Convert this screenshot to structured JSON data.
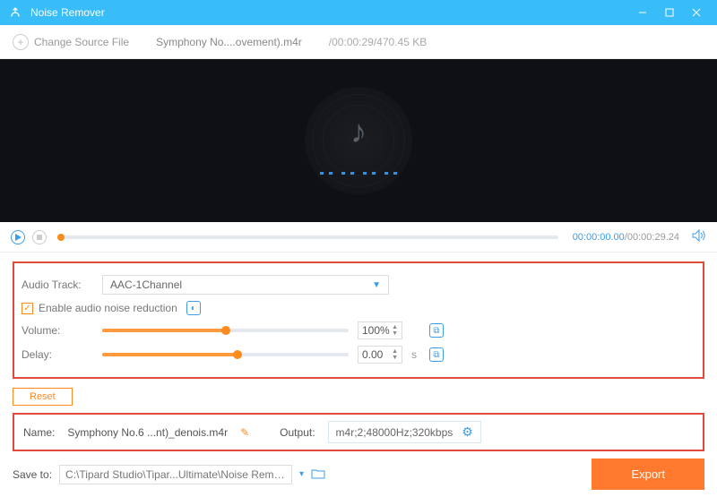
{
  "titlebar": {
    "title": "Noise Remover"
  },
  "toolbar": {
    "change_label": "Change Source File",
    "filename": "Symphony No....ovement).m4r",
    "fileinfo": "/00:00:29/470.45 KB"
  },
  "playbar": {
    "current": "00:00:00.00",
    "duration": "00:00:29.24"
  },
  "audio": {
    "track_label": "Audio Track:",
    "track_value": "AAC-1Channel",
    "enable_label": "Enable audio noise reduction",
    "volume_label": "Volume:",
    "volume_value": "100%",
    "volume_percent": 50,
    "delay_label": "Delay:",
    "delay_value": "0.00",
    "delay_unit": "s",
    "delay_percent": 55,
    "reset_label": "Reset"
  },
  "output": {
    "name_label": "Name:",
    "name_value": "Symphony No.6 ...nt)_denois.m4r",
    "output_label": "Output:",
    "output_format": "m4r;2;48000Hz;320kbps"
  },
  "footer": {
    "save_label": "Save to:",
    "save_path": "C:\\Tipard Studio\\Tipar...Ultimate\\Noise Remover",
    "export_label": "Export"
  }
}
